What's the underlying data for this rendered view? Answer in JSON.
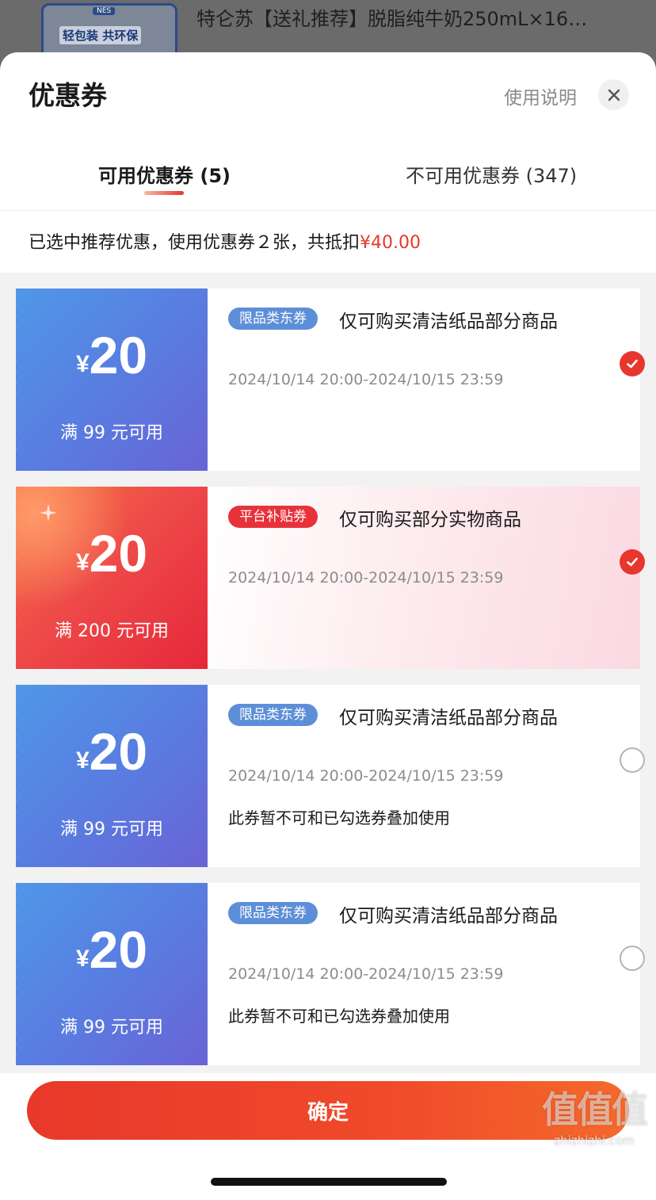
{
  "background_product": {
    "thumb_label": "轻包装 共环保",
    "thumb_tag": "NES",
    "title": "特仑苏【送礼推荐】脱脂纯牛奶250mL×16…"
  },
  "sheet": {
    "title": "优惠券",
    "help_link": "使用说明",
    "close_icon": "close-icon"
  },
  "tabs": [
    {
      "label": "可用优惠券 (5)",
      "active": true
    },
    {
      "label": "不可用优惠券 (347)",
      "active": false
    }
  ],
  "summary": {
    "text": "已选中推荐优惠，使用优惠券２张，共抵扣",
    "amount": "¥40.00"
  },
  "coupons": [
    {
      "currency": "¥",
      "amount": "20",
      "condition": "满 99 元可用",
      "badge": "限品类东券",
      "description": "仅可购买清洁纸品部分商品",
      "validity": "2024/10/14 20:00-2024/10/15 23:59",
      "note": "",
      "selected": true,
      "style": "blue"
    },
    {
      "currency": "¥",
      "amount": "20",
      "condition": "满 200 元可用",
      "badge": "平台补贴券",
      "description": "仅可购买部分实物商品",
      "validity": "2024/10/14 20:00-2024/10/15 23:59",
      "note": "",
      "selected": true,
      "style": "red"
    },
    {
      "currency": "¥",
      "amount": "20",
      "condition": "满 99 元可用",
      "badge": "限品类东券",
      "description": "仅可购买清洁纸品部分商品",
      "validity": "2024/10/14 20:00-2024/10/15 23:59",
      "note": "此券暂不可和已勾选券叠加使用",
      "selected": false,
      "style": "blue"
    },
    {
      "currency": "¥",
      "amount": "20",
      "condition": "满 99 元可用",
      "badge": "限品类东券",
      "description": "仅可购买清洁纸品部分商品",
      "validity": "2024/10/14 20:00-2024/10/15 23:59",
      "note": "此券暂不可和已勾选券叠加使用",
      "selected": false,
      "style": "blue"
    }
  ],
  "confirm_label": "确定",
  "watermark": {
    "mark": "值值值",
    "site": "zhizhizhi.com"
  },
  "colors": {
    "accent": "#e8382d",
    "blue_coupon": "#5a7be0",
    "red_coupon": "#ee4a49"
  }
}
